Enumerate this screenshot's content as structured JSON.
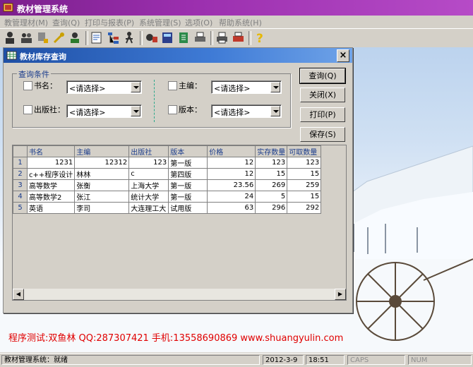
{
  "app": {
    "title": "教材管理系统"
  },
  "menu": [
    "教管理材(M)",
    "查询(Q)",
    "打印与报表(P)",
    "系统管理(S)",
    "选项(O)",
    "帮助系统(H)"
  ],
  "toolbar": {
    "buttons": [
      "users-icon",
      "group-icon",
      "key-icon",
      "wrench-icon",
      "profile-icon",
      "book-edit-icon",
      "tree-icon",
      "person-icon",
      "chart-icon",
      "calculator-icon",
      "export-icon",
      "printer-icon",
      "preview-icon",
      "help-icon"
    ]
  },
  "child": {
    "title": "教材库存查询",
    "close": "×",
    "group_title": "查询条件",
    "fields": {
      "book_label": "书名：",
      "book_value": "<请选择>",
      "editor_label": "主编：",
      "editor_value": "<请选择>",
      "publisher_label": "出版社：",
      "publisher_value": "<请选择>",
      "edition_label": "版本：",
      "edition_value": "<请选择>"
    },
    "buttons": {
      "query": "查询(Q)",
      "close": "关闭(X)",
      "print": "打印(P)",
      "save": "保存(S)"
    }
  },
  "table": {
    "columns": [
      "书名",
      "主编",
      "出版社",
      "版本",
      "价格",
      "实存数量",
      "可取数量"
    ],
    "rows": [
      [
        "1",
        "1231",
        "12312",
        "123",
        "第一版",
        "12",
        "123",
        "123"
      ],
      [
        "2",
        "c++程序设计",
        "林林",
        "c",
        "第四版",
        "12",
        "15",
        "15"
      ],
      [
        "3",
        "高等数学",
        "张衡",
        "上海大学",
        "第一版",
        "23.56",
        "269",
        "259"
      ],
      [
        "4",
        "高等数学2",
        "张江",
        "统计大学",
        "第一版",
        "24",
        "5",
        "15"
      ],
      [
        "5",
        "英语",
        "李司",
        "大连理工大",
        "试用版",
        "63",
        "296",
        "292"
      ]
    ]
  },
  "banner": "程序测试:双鱼林 QQ:287307421 手机:13558690869 www.shuangyulin.com",
  "status": {
    "main": "教材管理系统：就绪",
    "date": "2012-3-9",
    "time": "18:51",
    "caps": "CAPS",
    "num": "NUM"
  },
  "colors": {
    "title_purple": "#9b2fae",
    "child_title_blue": "#1e4fa5",
    "banner_red": "#e00000"
  }
}
